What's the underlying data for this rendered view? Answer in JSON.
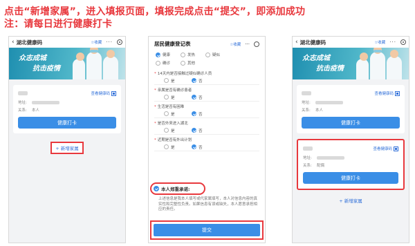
{
  "instructions": {
    "line1": "点击“新增家属”，进入填报页面，填报完成点击“提交”，即添加成功",
    "line2": "注：请每日进行健康打卡"
  },
  "app": {
    "title": "湖北健康码",
    "favorite": "☆收藏",
    "more": "···"
  },
  "banner": {
    "line1": "众志成城",
    "line2": "抗击疫情"
  },
  "card": {
    "code_link": "查看健康码",
    "address_label": "地址:",
    "relation_label": "关系:",
    "relation_self": "本人",
    "relation_spouse": "配偶",
    "checkin_button": "健康打卡"
  },
  "add_family": "+ 新增家属",
  "form": {
    "title": "居民健康登记表",
    "favorite": "☆收藏",
    "more": "···",
    "status_options": [
      "健康",
      "发热",
      "疑似",
      "确诊",
      "其他"
    ],
    "status_selected": "健康",
    "questions": [
      {
        "text": "14天内是否接触过疑似确诊人员",
        "yes": "是",
        "no": "否",
        "selected": "否"
      },
      {
        "text": "亲属是否有确诊患者",
        "yes": "是",
        "no": "否",
        "selected": "否"
      },
      {
        "text": "生活是否有困难",
        "yes": "是",
        "no": "否",
        "selected": "否"
      },
      {
        "text": "是否外来进入湖北",
        "yes": "是",
        "no": "否",
        "selected": "否"
      },
      {
        "text": "近期是否有外出计划",
        "yes": "是",
        "no": "否",
        "selected": "否"
      }
    ],
    "promise_label": "本人郑重承诺:",
    "promise_text": "上述信息是我本人填写或代家属填写，本人对信息内容的真实性和完整性负责。如果信息有误或缺失，本人愿意承担相应的责任。",
    "submit_button": "提交"
  },
  "colors": {
    "accent": "#e8383d",
    "primary": "#3a8ee6",
    "link": "#2f6fd9"
  }
}
